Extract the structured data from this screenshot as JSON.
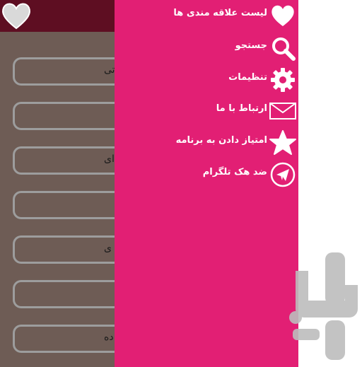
{
  "background_list": {
    "items": [
      "تی",
      "",
      "ای",
      "",
      "ی",
      "",
      "ده"
    ]
  },
  "drawer": {
    "items": [
      {
        "label": "لیست علاقه مندی ها",
        "icon": "heart-icon"
      },
      {
        "label": "جستجو",
        "icon": "search-icon"
      },
      {
        "label": "تنظیمات",
        "icon": "gear-icon"
      },
      {
        "label": "ارتباط با ما",
        "icon": "mail-icon"
      },
      {
        "label": "امتیاز دادن به برنامه",
        "icon": "star-icon"
      },
      {
        "label": "ضد هک تلگرام",
        "icon": "telegram-icon"
      }
    ]
  },
  "colors": {
    "drawer": "#e21f74",
    "header": "#5e0e22",
    "background": "#6e5c55",
    "item_border": "#9d9d9d"
  },
  "watermark": {
    "icon": "cafebazaar-logo-icon"
  }
}
